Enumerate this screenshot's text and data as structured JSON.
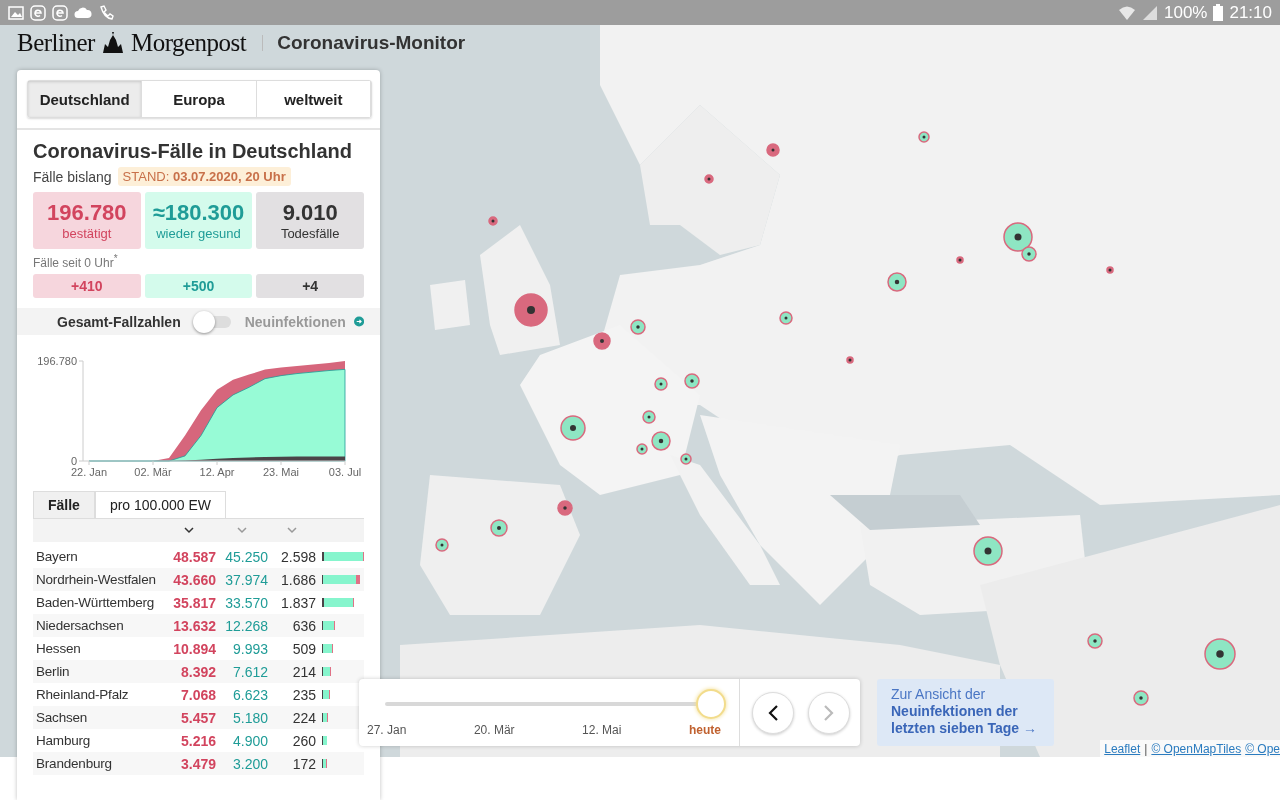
{
  "status_bar": {
    "battery": "100%",
    "time": "21:10"
  },
  "header": {
    "logo_left": "Berliner",
    "logo_right": "Morgenpost",
    "title": "Coronavirus-Monitor"
  },
  "region_tabs": [
    {
      "label": "Deutschland",
      "selected": true
    },
    {
      "label": "Europa",
      "selected": false
    },
    {
      "label": "weltweit",
      "selected": false
    }
  ],
  "summary": {
    "title": "Coronavirus-Fälle in Deutschland",
    "subtitle": "Fälle bislang",
    "stand": "STAND: **03.07.2020, 20 Uhr**",
    "totals": [
      {
        "kind": "confirmed",
        "value": "196.780",
        "label": "bestätigt"
      },
      {
        "kind": "recovered",
        "value": "≈180.300",
        "label": "wieder gesund"
      },
      {
        "kind": "deaths",
        "value": "9.010",
        "label": "Todesfälle"
      }
    ],
    "today_label": "Fälle seit 0 Uhr$^{*}$",
    "today": [
      {
        "kind": "confirmed",
        "value": "+410"
      },
      {
        "kind": "recovered",
        "value": "+500"
      },
      {
        "kind": "deaths",
        "value": "+4"
      }
    ]
  },
  "mode_toggle": {
    "left": "Gesamt-Fallzahlen",
    "right": "Neuinfektionen",
    "on": false
  },
  "chart_data": {
    "type": "area",
    "categories": [
      "22. Jan",
      null,
      null,
      null,
      "02. Mär",
      null,
      null,
      null,
      "12. Apr",
      null,
      null,
      null,
      "23. Mai",
      null,
      null,
      null,
      "03. Jul"
    ],
    "yticks": [
      0,
      {
        "value": 196780,
        "label": "196.780"
      }
    ],
    "ylim": [
      0,
      196780
    ],
    "stacked": false,
    "series": [
      {
        "color": "#d6667c",
        "values": [
          0,
          0,
          0,
          0,
          0,
          6000,
          50000,
          100000,
          140000,
          160000,
          170000,
          180000,
          184000,
          187000,
          190000,
          193000,
          196780
        ]
      },
      {
        "color": "#97fbd6",
        "values": [
          0,
          0,
          0,
          0,
          0,
          0,
          10000,
          50000,
          105000,
          130000,
          145000,
          162000,
          168000,
          172000,
          175000,
          178000,
          180300
        ]
      },
      {
        "color": "#4a4448",
        "values": [
          0,
          0,
          0,
          0,
          0,
          0,
          1000,
          2500,
          4500,
          6000,
          7000,
          8000,
          8500,
          8700,
          8800,
          8900,
          9000
        ]
      }
    ]
  },
  "table_tabs": [
    {
      "label": "Fälle",
      "selected": true
    },
    {
      "label": "pro 100.000 EW",
      "selected": false
    }
  ],
  "sort_columns": [
    {
      "selected": true
    },
    {
      "selected": false
    },
    {
      "selected": false
    }
  ],
  "rows": [
    {
      "name": "Bayern",
      "confirmed": "48.587",
      "recovered": "45.250",
      "deaths": "2.598"
    },
    {
      "name": "Nordrhein-Westfalen",
      "confirmed": "43.660",
      "recovered": "37.974",
      "deaths": "1.686"
    },
    {
      "name": "Baden-Württemberg",
      "confirmed": "35.817",
      "recovered": "33.570",
      "deaths": "1.837"
    },
    {
      "name": "Niedersachsen",
      "confirmed": "13.632",
      "recovered": "12.268",
      "deaths": "636"
    },
    {
      "name": "Hessen",
      "confirmed": "10.894",
      "recovered": "9.993",
      "deaths": "509"
    },
    {
      "name": "Berlin",
      "confirmed": "8.392",
      "recovered": "7.612",
      "deaths": "214"
    },
    {
      "name": "Rheinland-Pfalz",
      "confirmed": "7.068",
      "recovered": "6.623",
      "deaths": "235"
    },
    {
      "name": "Sachsen",
      "confirmed": "5.457",
      "recovered": "5.180",
      "deaths": "224"
    },
    {
      "name": "Hamburg",
      "confirmed": "5.216",
      "recovered": "4.900",
      "deaths": "260"
    },
    {
      "name": "Brandenburg",
      "confirmed": "3.479",
      "recovered": "3.200",
      "deaths": "172"
    }
  ],
  "timeline": {
    "level": 1,
    "ticks": [
      {
        "label": "27. Jan",
        "selected": false
      },
      {
        "label": "20. Mär",
        "selected": false
      },
      {
        "label": "12. Mai",
        "selected": false
      },
      {
        "label": "heute",
        "selected": true
      }
    ],
    "prev_disabled": false,
    "next_disabled": true
  },
  "info_link": "Zur Ansicht der **Neuinfektionen der letzten sieben Tage** →",
  "attribution": [
    {
      "kind": "link",
      "text": "Leaflet"
    },
    {
      "kind": "text",
      "text": "|"
    },
    {
      "kind": "link",
      "text": "© OpenMapTiles"
    },
    {
      "kind": "link",
      "text": "© Ope"
    }
  ]
}
